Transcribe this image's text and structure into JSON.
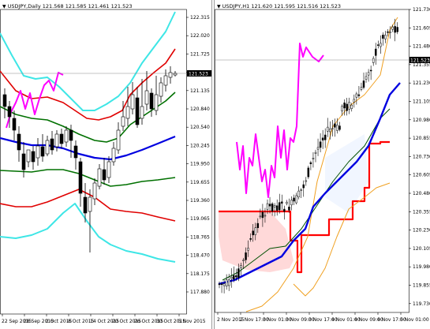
{
  "left_chart": {
    "title": "USDJPY,Daily  121.568 121.585 121.461 121.523",
    "price_badge": "121.523",
    "y_ticks": [
      "122.315",
      "122.020",
      "121.725",
      "121.430",
      "121.135",
      "120.840",
      "120.540",
      "120.245",
      "119.950",
      "119.655",
      "119.360",
      "119.065",
      "118.765",
      "118.470",
      "118.175",
      "117.880"
    ],
    "x_ticks": [
      "22 Sep 2015",
      "28 Sep 2015",
      "2 Oct 2015",
      "8 Oct 2015",
      "14 Oct 2015",
      "20 Oct 2015",
      "26 Oct 2015",
      "30 Oct 2015",
      "5 Nov 2015"
    ]
  },
  "right_chart": {
    "title": "USDJPY,H1  121.620 121.595 121.516 121.523",
    "price_badge": "121.523",
    "y_ticks": [
      "121.730",
      "121.605",
      "121.480",
      "121.355",
      "121.230",
      "121.105",
      "120.980",
      "120.855",
      "120.730",
      "120.605",
      "120.480",
      "120.355",
      "120.230",
      "120.105",
      "119.980",
      "119.855",
      "119.730"
    ],
    "x_ticks": [
      "2 Nov 2015",
      "2 Nov 17:00",
      "3 Nov 01:00",
      "3 Nov 09:00",
      "3 Nov 17:00",
      "4 Nov 01:00",
      "4 Nov 09:00",
      "4 Nov 17:00",
      "5 Nov 01:00"
    ]
  },
  "colors": {
    "bull_candle": "#ffffff",
    "bear_candle": "#000000",
    "band_cyan": "#3ee6e6",
    "band_red": "#e00000",
    "band_green": "#007000",
    "ma_blue": "#0000e0",
    "chikou_magenta": "#ff00ff",
    "kumo_orange": "#f0a020",
    "kijun_red": "#ff0000",
    "tenkan_darkgreen": "#005000",
    "cloud_pink": "#ffd0d0"
  }
}
